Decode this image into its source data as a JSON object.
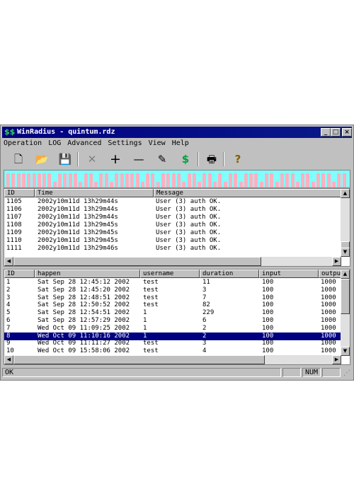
{
  "window": {
    "title": "WinRadius - quintum.rdz",
    "app_icon": "dollar-network-icon",
    "controls": [
      "_",
      "□",
      "×"
    ]
  },
  "menu": [
    "Operation",
    "LOG",
    "Advanced",
    "Settings",
    "View",
    "Help"
  ],
  "toolbar": {
    "icons": [
      "new-file-icon",
      "open-folder-icon",
      "save-icon",
      "delete-icon",
      "add-icon",
      "remove-icon",
      "edit-icon",
      "billing-icon",
      "print-icon",
      "help-icon"
    ],
    "glyphs": [
      "🗋",
      "📂",
      "💾",
      "✕",
      "+",
      "—",
      "✎",
      "$",
      "🖶",
      "?"
    ]
  },
  "traffic_graph": {
    "background": "#80ffff",
    "bar_color": "#ffb0c0",
    "levels": [
      0.75,
      0.75,
      0.75,
      0.75,
      0.75,
      0.75,
      0.75,
      0.75,
      0.75,
      0.3,
      0.75,
      0.75,
      0.75,
      0.75,
      0.3,
      0.75,
      0.75,
      0.3,
      0.75,
      0.75,
      0.3,
      0.75,
      0.75,
      0.75,
      0.75,
      0.75,
      0.3,
      0.75,
      0.75,
      0.3,
      0.75,
      0.75,
      0.75,
      0.75,
      0.3,
      0.75,
      0.75,
      0.3,
      0.75,
      0.75,
      0.3,
      0.75,
      0.3,
      0.75,
      0.75,
      0.3,
      0.75,
      0.75,
      0.75,
      0.3,
      0.75,
      0.75,
      0.3,
      0.75,
      0.75,
      0.75,
      0.3,
      0.75,
      0.75,
      0.3,
      0.75,
      0.75,
      0.75,
      0.3,
      0.75,
      0.75
    ]
  },
  "log_table": {
    "columns": [
      "ID",
      "Time",
      "Message"
    ],
    "rows": [
      {
        "id": "1105",
        "time": "2002y10m11d 13h29m44s",
        "message": "User (3) auth OK."
      },
      {
        "id": "1106",
        "time": "2002y10m11d 13h29m44s",
        "message": "User (3) auth OK."
      },
      {
        "id": "1107",
        "time": "2002y10m11d 13h29m44s",
        "message": "User (3) auth OK."
      },
      {
        "id": "1108",
        "time": "2002y10m11d 13h29m45s",
        "message": "User (3) auth OK."
      },
      {
        "id": "1109",
        "time": "2002y10m11d 13h29m45s",
        "message": "User (3) auth OK."
      },
      {
        "id": "1110",
        "time": "2002y10m11d 13h29m45s",
        "message": "User (3) auth OK."
      },
      {
        "id": "1111",
        "time": "2002y10m11d 13h29m46s",
        "message": "User (3) auth OK."
      }
    ]
  },
  "session_table": {
    "columns": [
      "ID",
      "happen",
      "username",
      "duration",
      "input",
      "output"
    ],
    "selected_index": 7,
    "rows": [
      {
        "id": "1",
        "happen": "Sat Sep 28 12:45:12 2002",
        "username": "test",
        "duration": "11",
        "input": "100",
        "output": "1000"
      },
      {
        "id": "2",
        "happen": "Sat Sep 28 12:45:20 2002",
        "username": "test",
        "duration": "3",
        "input": "100",
        "output": "1000"
      },
      {
        "id": "3",
        "happen": "Sat Sep 28 12:48:51 2002",
        "username": "test",
        "duration": "7",
        "input": "100",
        "output": "1000"
      },
      {
        "id": "4",
        "happen": "Sat Sep 28 12:50:52 2002",
        "username": "test",
        "duration": "82",
        "input": "100",
        "output": "1000"
      },
      {
        "id": "5",
        "happen": "Sat Sep 28 12:54:51 2002",
        "username": "1",
        "duration": "229",
        "input": "100",
        "output": "1000"
      },
      {
        "id": "6",
        "happen": "Sat Sep 28 12:57:29 2002",
        "username": "1",
        "duration": "6",
        "input": "100",
        "output": "1000"
      },
      {
        "id": "7",
        "happen": "Wed Oct 09 11:09:25 2002",
        "username": "1",
        "duration": "2",
        "input": "100",
        "output": "1000"
      },
      {
        "id": "8",
        "happen": "Wed Oct 09 11:10:16 2002",
        "username": "1",
        "duration": "2",
        "input": "100",
        "output": "1000"
      },
      {
        "id": "9",
        "happen": "Wed Oct 09 11:11:27 2002",
        "username": "test",
        "duration": "3",
        "input": "100",
        "output": "1000"
      },
      {
        "id": "10",
        "happen": "Wed Oct 09 15:58:06 2002",
        "username": "test",
        "duration": "4",
        "input": "100",
        "output": "1000"
      }
    ]
  },
  "status": {
    "text": "OK",
    "num": "NUM"
  }
}
